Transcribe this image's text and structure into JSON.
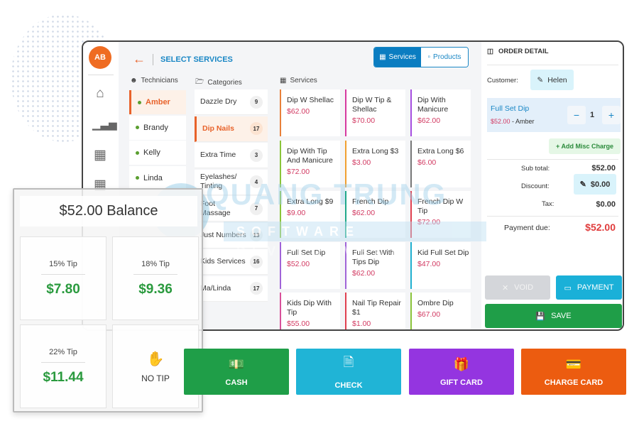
{
  "watermark": {
    "line1": "QUANG TRUNG",
    "line2": "SOFTWARE DEVELOPMENT"
  },
  "nav": {
    "avatar": "AB",
    "icons": [
      "home-icon",
      "chart-icon",
      "calendar-icon",
      "grid-icon",
      "settings-icon",
      "logout-icon"
    ]
  },
  "header": {
    "title": "SELECT SERVICES",
    "tabs": [
      {
        "label": "Services",
        "active": true
      },
      {
        "label": "Products",
        "active": false
      }
    ]
  },
  "columns": {
    "technicians": "Technicians",
    "categories": "Categories",
    "services": "Services"
  },
  "technicians": [
    {
      "name": "Amber",
      "selected": true
    },
    {
      "name": "Brandy"
    },
    {
      "name": "Kelly"
    },
    {
      "name": "Linda"
    }
  ],
  "categories": [
    {
      "name": "Dazzle Dry",
      "count": "9"
    },
    {
      "name": "Dip Nails",
      "count": "17",
      "selected": true
    },
    {
      "name": "Extra Time",
      "count": "3"
    },
    {
      "name": "Eyelashes/ Tinting",
      "count": "4"
    },
    {
      "name": "Foot Massage",
      "count": "7"
    },
    {
      "name": "Just Numbers",
      "count": "13"
    },
    {
      "name": "Kids Services",
      "count": "16"
    },
    {
      "name": "Ma/Linda",
      "count": "17"
    }
  ],
  "services": [
    {
      "name": "Dip W Shellac",
      "price": "$62.00",
      "color": "#e8803a"
    },
    {
      "name": "Dip W Tip & Shellac",
      "price": "$70.00",
      "color": "#d63aa0"
    },
    {
      "name": "Dip With Manicure",
      "price": "$62.00",
      "color": "#a64ee0"
    },
    {
      "name": "Dip With Tip And Manicure",
      "price": "$72.00",
      "color": "#8ac43a"
    },
    {
      "name": "Extra Long $3",
      "price": "$3.00",
      "color": "#f0a030"
    },
    {
      "name": "Extra Long $6",
      "price": "$6.00",
      "color": "#777777"
    },
    {
      "name": "Extra Long $9",
      "price": "$9.00",
      "color": "#8ac43a"
    },
    {
      "name": "French Dip",
      "price": "$62.00",
      "color": "#20a88a"
    },
    {
      "name": "French Dip W Tip",
      "price": "$72.00",
      "color": "#e04050"
    },
    {
      "name": "Full Set Dip",
      "price": "$52.00",
      "color": "#a064d8"
    },
    {
      "name": "Full Set With Tips Dip",
      "price": "$62.00",
      "color": "#a064d8"
    },
    {
      "name": "Kid Full Set Dip",
      "price": "$47.00",
      "color": "#20b0d0"
    },
    {
      "name": "Kids Dip With Tip",
      "price": "$55.00",
      "color": "#d8509a"
    },
    {
      "name": "Nail Tip Repair $1",
      "price": "$1.00",
      "color": "#e04050"
    },
    {
      "name": "Ombre Dip",
      "price": "$67.00",
      "color": "#8ac43a"
    }
  ],
  "order": {
    "title": "ORDER DETAIL",
    "customer_label": "Customer:",
    "customer": "Helen",
    "item": {
      "name": "Full Set Dip",
      "price": "$52.00",
      "tech": " - Amber",
      "qty": "1"
    },
    "misc": "+ Add Misc Charge",
    "subtotal_label": "Sub total:",
    "subtotal": "$52.00",
    "discount_label": "Discount:",
    "discount": "$0.00",
    "tax_label": "Tax:",
    "tax": "$0.00",
    "due_label": "Payment due:",
    "due": "$52.00",
    "void": "VOID",
    "payment": "PAYMENT",
    "save": "SAVE"
  },
  "balance": {
    "title": "$52.00 Balance",
    "tips": [
      {
        "label": "15% Tip",
        "amount": "$7.80"
      },
      {
        "label": "18% Tip",
        "amount": "$9.36"
      },
      {
        "label": "22% Tip",
        "amount": "$11.44"
      }
    ],
    "no_tip": "NO TIP"
  },
  "payment_methods": [
    {
      "label": "CASH",
      "color": "#1f9e48"
    },
    {
      "label": "CHECK",
      "color": "#20b4d6"
    },
    {
      "label": "GIFT CARD",
      "color": "#9435e0"
    },
    {
      "label": "CHARGE CARD",
      "color": "#ec5c10"
    }
  ]
}
